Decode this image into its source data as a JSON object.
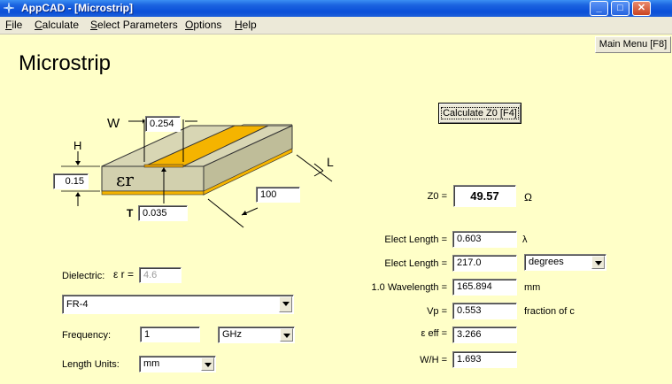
{
  "window": {
    "title": "AppCAD - [Microstrip]",
    "min": "_",
    "max": "□",
    "close": "✕"
  },
  "menu": {
    "file": {
      "u": "F",
      "rest": "ile"
    },
    "calculate": {
      "u": "C",
      "rest": "alculate"
    },
    "select": {
      "u": "S",
      "rest": "elect Parameters"
    },
    "options": {
      "u": "O",
      "rest": "ptions"
    },
    "help": {
      "u": "H",
      "rest": "elp"
    }
  },
  "main_menu_button": "Main Menu [F8]",
  "page_title": "Microstrip",
  "calc_button": "Calculate Z0  [F4]",
  "diagram": {
    "w_label": "W",
    "w_value": "0.254",
    "h_label": "H",
    "h_value": "0.15",
    "t_label": "T",
    "t_value": "0.035",
    "l_label": "L",
    "l_value": "100",
    "er_symbol": "εr"
  },
  "dielectric": {
    "label": "Dielectric:",
    "er_label": "ε r =",
    "er_value": "4.6",
    "material": "FR-4"
  },
  "frequency": {
    "label": "Frequency:",
    "value": "1",
    "unit": "GHz"
  },
  "length_units": {
    "label": "Length Units:",
    "value": "mm"
  },
  "results": {
    "z0": {
      "label": "Z0 =",
      "value": "49.57",
      "unit": "Ω"
    },
    "elect_length_lambda": {
      "label": "Elect Length =",
      "value": "0.603",
      "unit": "λ"
    },
    "elect_length_deg": {
      "label": "Elect Length =",
      "value": "217.0",
      "unit": "degrees"
    },
    "wavelength": {
      "label": "1.0 Wavelength =",
      "value": "165.894",
      "unit": "mm"
    },
    "vp": {
      "label": "Vp =",
      "value": "0.553",
      "unit": "fraction of c"
    },
    "eeff": {
      "label": "ε eff =",
      "value": "3.266"
    },
    "wh": {
      "label": "W/H =",
      "value": "1.693"
    }
  },
  "colors": {
    "background": "#ffffc8",
    "substrate": "#d6d4b0",
    "trace": "#f5b400",
    "titlebar": "#0a4fd8"
  }
}
